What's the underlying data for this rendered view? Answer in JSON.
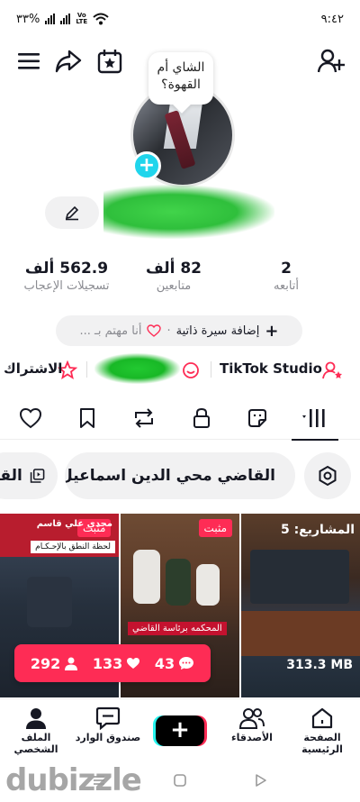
{
  "status_bar": {
    "battery": "٣٣%",
    "time": "٩:٤٢",
    "volte_top": "Vo",
    "volte_bottom": "LTE"
  },
  "profile": {
    "bubble_text": "الشاي أم القهوة؟",
    "stats": [
      {
        "value": "2",
        "label": "أتابعه"
      },
      {
        "value": "82 ألف",
        "label": "متابعين"
      },
      {
        "value": "562.9 ألف",
        "label": "تسجيلات الإعجاب"
      }
    ],
    "bio_add": "إضافة سيرة ذاتية",
    "interest": "أنا مهتم بـ ..."
  },
  "links": {
    "studio": "TikTok Studio",
    "subscribe": "الاشتراك"
  },
  "playlists": [
    "القاضي محي الدين اسماعيل",
    "القا"
  ],
  "videos": [
    {
      "pinned": "مثبت",
      "caption_top": "مجدي علي قاسم",
      "caption_2": "لحظة النطق بالإحـكـام"
    },
    {
      "pinned": "مثبت",
      "caption": "المحكمه برئاسة القاضي"
    },
    {
      "pinned": "",
      "projects": "المشاريع: 5",
      "size": "313.3 MB"
    }
  ],
  "post_stats": {
    "views": "292",
    "likes": "133",
    "comments": "43"
  },
  "bottom_nav": {
    "home": "الصفحة الرئيسية",
    "friends": "الأصدقاء",
    "inbox": "صندوق الوارد",
    "profile": "الملف الشخصي"
  },
  "watermark": "dubizzle",
  "colors": {
    "accent": "#fe2c55",
    "cyan": "#20d5ec"
  }
}
